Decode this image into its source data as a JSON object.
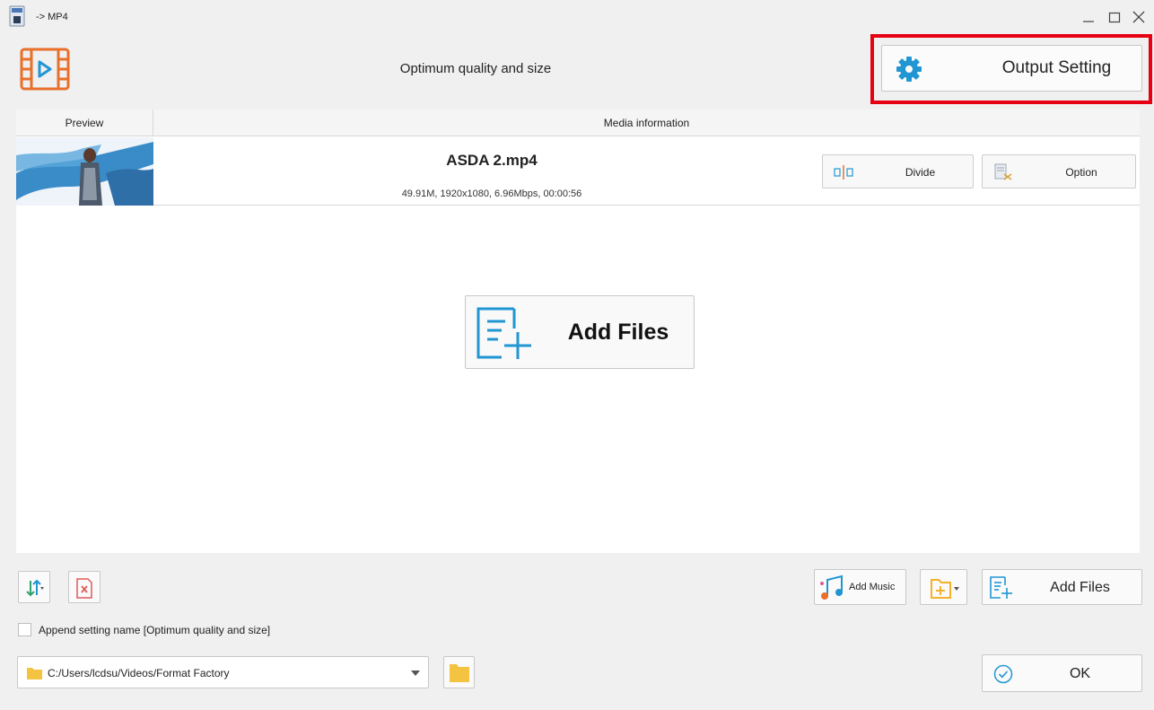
{
  "window": {
    "title": "-> MP4",
    "minimize_glyph": "_",
    "maximize_glyph": "□",
    "close_glyph": "✕"
  },
  "header": {
    "quality_label": "Optimum quality and size",
    "output_setting_label": "Output Setting",
    "highlight_color": "#e60012"
  },
  "table": {
    "columns": [
      "Preview",
      "Media information"
    ],
    "files": [
      {
        "name": "ASDA 2.mp4",
        "meta": "49.91M, 1920x1080, 6.96Mbps, 00:00:56",
        "divide_label": "Divide",
        "option_label": "Option"
      }
    ]
  },
  "main": {
    "add_files_label": "Add Files"
  },
  "toolbar": {
    "add_music_label": "Add Music",
    "add_files_label": "Add Files",
    "append_setting_label": "Append setting name [Optimum quality and size]",
    "append_checked": false
  },
  "output": {
    "path": "C:/Users/lcdsu/Videos/Format Factory",
    "ok_label": "OK"
  },
  "colors": {
    "accent_blue": "#2196d3",
    "film_orange": "#e8702a",
    "folder_yellow": "#f5c342"
  }
}
